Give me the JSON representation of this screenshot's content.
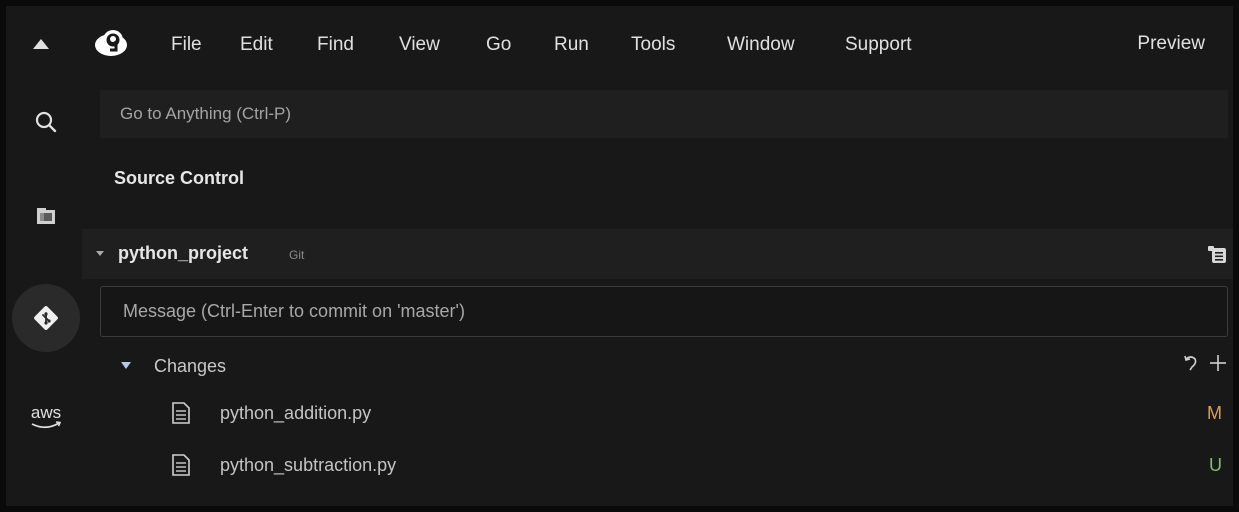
{
  "menubar": {
    "items": [
      "File",
      "Edit",
      "Find",
      "View",
      "Go",
      "Run",
      "Tools",
      "Window",
      "Support"
    ],
    "preview": "Preview",
    "logo_icon": "cloud9-logo-icon",
    "collapse_icon": "triangle-up-icon"
  },
  "activity": {
    "items": [
      {
        "name": "search",
        "icon": "search-icon"
      },
      {
        "name": "environment",
        "icon": "folder-icon"
      },
      {
        "name": "source-control",
        "icon": "git-icon",
        "active": true
      },
      {
        "name": "aws",
        "icon": "aws-icon",
        "label": "aws"
      }
    ]
  },
  "goto": {
    "placeholder": "Go to Anything (Ctrl-P)"
  },
  "panel": {
    "title": "Source Control"
  },
  "repo": {
    "name": "python_project",
    "tag": "Git",
    "menu_icon": "list-menu-icon"
  },
  "commit": {
    "placeholder": "Message (Ctrl-Enter to commit on 'master')"
  },
  "changes": {
    "label": "Changes",
    "files": [
      {
        "name": "python_addition.py",
        "status": "M",
        "status_color": "#d9a055"
      },
      {
        "name": "python_subtraction.py",
        "status": "U",
        "status_color": "#7fc06a"
      }
    ]
  },
  "colors": {
    "background": "#181818",
    "accent": "#b8c8e8",
    "modified": "#d9a055",
    "untracked": "#7fc06a"
  }
}
